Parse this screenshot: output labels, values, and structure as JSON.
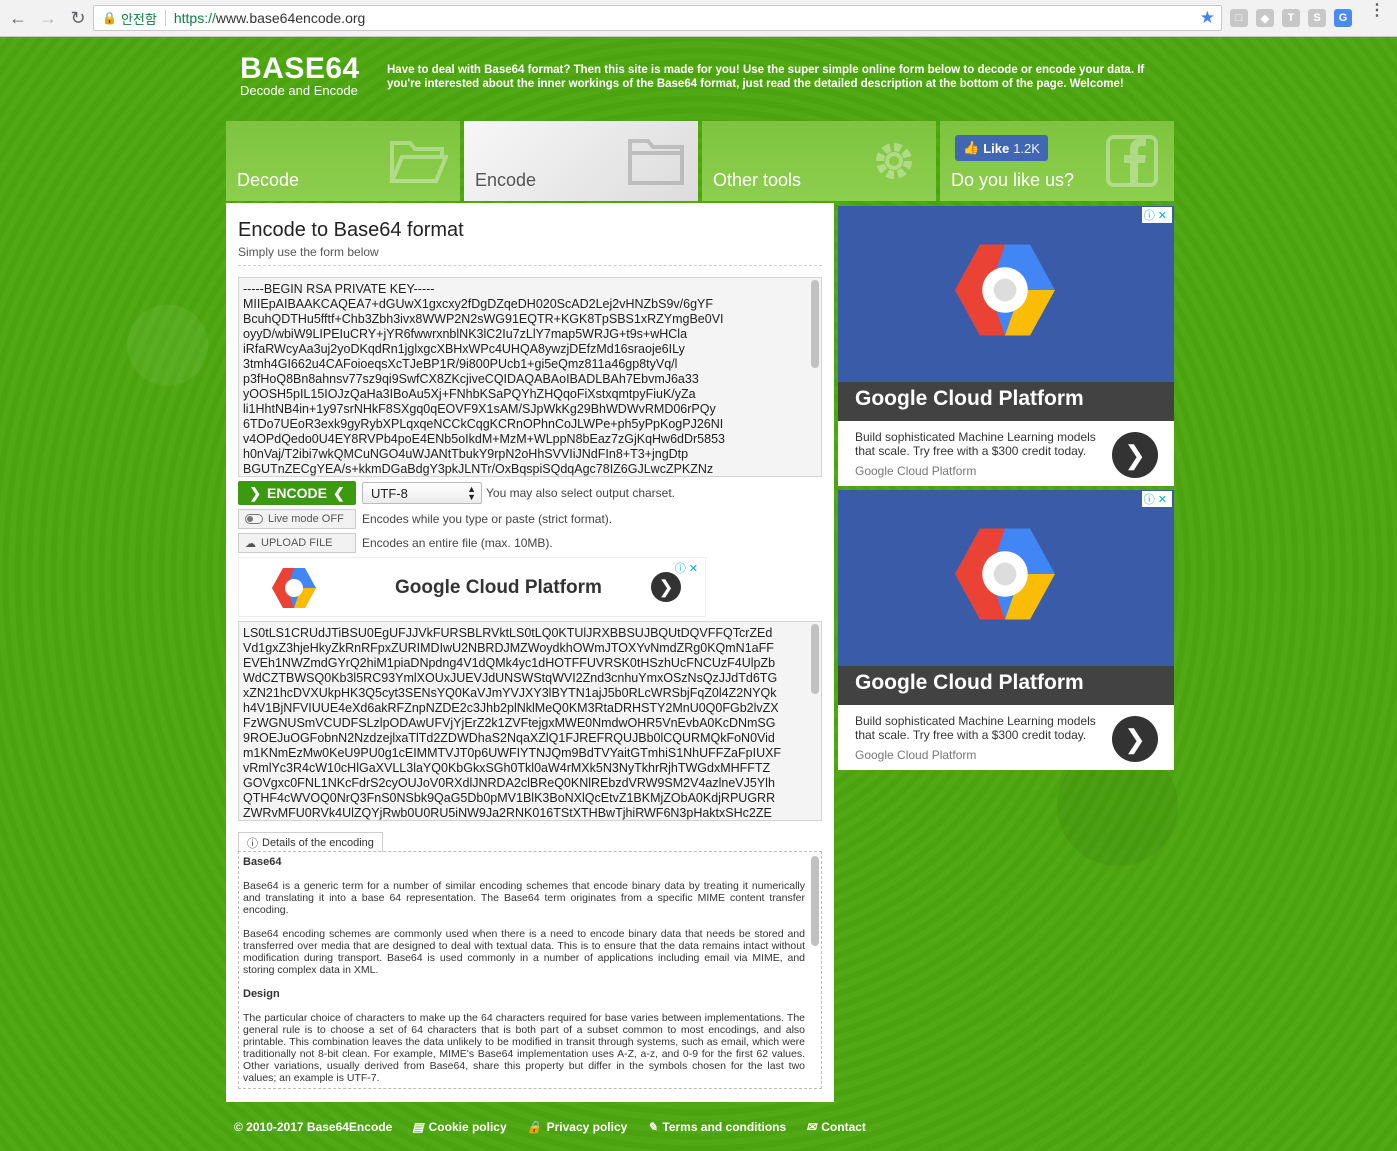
{
  "browser": {
    "secure_label": "안전함",
    "url_scheme": "https://",
    "url_host": "www.base64encode.org",
    "extensions": [
      "T",
      "S",
      "G"
    ]
  },
  "header": {
    "logo_title": "BASE64",
    "logo_sub": "Decode and Encode",
    "intro": "Have to deal with Base64 format? Then this site is made for you! Use the super simple online form below to decode or encode your data. If you're interested about the inner workings of the Base64 format, just read the detailed description at the bottom of the page. Welcome!"
  },
  "tabs": {
    "decode": "Decode",
    "encode": "Encode",
    "other_tools": "Other tools",
    "like_us": "Do you like us?",
    "fb_like": "Like",
    "fb_count": "1.2K"
  },
  "main": {
    "title": "Encode to Base64 format",
    "subtitle": "Simply use the form below",
    "input_lines": [
      "-----BEGIN RSA PRIVATE KEY-----",
      "MIIEpAIBAAKCAQEA7+dGUwX1gxcxy2fDgDZqeDH020ScAD2Lej2vHNZbS9v/6gYF",
      "BcuhQDTHu5fftf+Chb3Zbh3ivx8WWP2N2sWG91EQTR+KGK8TpSBS1xRZYmgBe0VI",
      "oyyD/wbiW9LIPEIuCRY+jYR6fwwrxnblNK3lC2Iu7zLlY7map5WRJG+t9s+wHCla",
      "iRfaRWcyAa3uj2yoDKqdRn1jglxgcXBHxWPc4UHQA8ywzjDEfzMd16sraoje6ILy",
      "3tmh4GI662u4CAFoioeqsXcTJeBP1R/9i800PUcb1+gi5eQmz811a46gp8tyVq/l",
      "p3fHoQ8Bn8ahnsv77sz9qi9SwfCX8ZKcjiveCQIDAQABAoIBADLBAh7EbvmJ6a33",
      "yOOSH5pIL15IOJzQaHa3IBoAu5Xj+FNhbKSaPQYhZHQqoFiXstxqmtpyFiuK/yZa",
      "li1HhtNB4in+1y97srNHkF8SXgq0qEOVF9X1sAM/SJpWkKg29BhWDWvRMD06rPQy",
      "6TDo7UEoR3exk9gyRybXPLqxqeNCCkCqgKCRnOPhnCoJLWPe+ph5yPpKogPJ26NI",
      "v4OPdQedo0U4EY8RVPb4poE4ENb5oIkdM+MzM+WLppN8bEaz7zGjKqHw6dDr5853",
      "h0nVaj/T2ibi7wkQMCuNGO4uWJANtTbukY9rpN2oHhSVVIiJNdFIn8+T3+jngDtp",
      "BGUTnZECgYEA/s+kkmDGaBdgY3pkJLNTr/OxBqspiSQdqAgc78IZ6GJLwcZPKZNz"
    ],
    "encode_btn": "ENCODE",
    "charset": "UTF-8",
    "charset_hint": "You may also select output charset.",
    "live_mode": "Live mode OFF",
    "live_hint": "Encodes while you type or paste (strict format).",
    "upload": "UPLOAD FILE",
    "upload_hint": "Encodes an entire file (max. 10MB).",
    "output_lines": [
      "LS0tLS1CRUdJTiBSU0EgUFJJVkFURSBLRVktLS0tLQ0KTUlJRXBBSUJBQUtDQVFFQTcrZEd",
      "Vd1gxZ3hjeHkyZkRnRFpxZURIMDIwU2NBRDJMZWoydkhOWmJTOXYvNmdZRg0KQmN1aFF",
      "EVEh1NWZmdGYrQ2hiM1piaDNpdng4V1dQMk4yc1dHOTFFUVRSK0tHSzhUcFNCUzF4UlpZb",
      "WdCZTBWSQ0Kb3l5RC93YmlXOUxJUEVJdUNSWStqWVI2Znd3cnhuYmxOSzNsQzJJdTd6TG",
      "xZN21hcDVXUkpHK3Q5cyt3SENsYQ0KaVJmYVJXY3lBYTN1ajJ5b0RLcWRSbjFqZ0l4Z2NYQk",
      "h4V1BjNFVIUUE4eXd6akRFZnpNZDE2c3Jhb2plNklMeQ0KM3RtaDRHSTY2MnU0Q0FGb2lvZX",
      "FzWGNUSmVCUDFSLzlpODAwUFVjYjErZ2k1ZVFtejgxMWE0NmdwOHR5VnEvbA0KcDNmSG",
      "9ROEJuOGFobnN2NzdzejlxaTlTd2ZDWDhaS2NqaXZlQ1FJREFRQUJBb0lCQURMQkFoN0Vid",
      "m1KNmEzMw0KeU9PU0g1cEIMMTVJT0p6UWFIYTNJQm9BdTVYaitGTmhiS1NhUFFZaFpIUXF",
      "vRmlYc3R4cW10cHlGaXVLL3laYQ0KbGkxSGh0Tkl0aW4rMXk5N3NyTkhrRjhTWGdxMHFFTZ",
      "GOVgxc0FNL1NKcFdrS2cyOUJoV0RXdlJNRDA2clBReQ0KNlREbzdVRW9SM2V4azlneVJ5Ylh",
      "QTHF4cWVOQ0NrQ3FnS0NSbk9QaG5Db0pMV1BlK3BoNXlQcEtvZ1BKMjZObA0KdjRPUGRR",
      "ZWRvMFU0RVk4UlZQYjRwb0U0RU5iNW9Ja2RNK016TStXTHBwTjhiRWF6N3pHaktxSHc2ZE"
    ],
    "ad_title": "Google Cloud Platform",
    "details_tab": "Details of the encoding",
    "details": {
      "h1": "Base64",
      "p1": "Base64 is a generic term for a number of similar encoding schemes that encode binary data by treating it numerically and translating it into a base 64 representation. The Base64 term originates from a specific MIME content transfer encoding.",
      "p2": "Base64 encoding schemes are commonly used when there is a need to encode binary data that needs be stored and transferred over media that are designed to deal with textual data. This is to ensure that the data remains intact without modification during transport. Base64 is used commonly in a number of applications including email via MIME, and storing complex data in XML.",
      "h2": "Design",
      "p3": "The particular choice of characters to make up the 64 characters required for base varies between implementations. The general rule is to choose a set of 64 characters that is both part of a subset common to most encodings, and also printable. This combination leaves the data unlikely to be modified in transit through systems, such as email, which were traditionally not 8-bit clean. For example, MIME's Base64 implementation uses A-Z, a-z, and 0-9 for the first 62 values. Other variations, usually derived from Base64, share this property but differ in the symbols chosen for the last two values; an example is UTF-7."
    }
  },
  "side_ads": [
    {
      "title": "Google Cloud Platform",
      "desc": "Build sophisticated Machine Learning models that scale. Try free with a $300 credit today.",
      "source": "Google Cloud Platform"
    },
    {
      "title": "Google Cloud Platform",
      "desc": "Build sophisticated Machine Learning models that scale. Try free with a $300 credit today.",
      "source": "Google Cloud Platform"
    }
  ],
  "footer": {
    "copyright": "© 2010-2017 Base64Encode",
    "cookie": "Cookie policy",
    "privacy": "Privacy policy",
    "terms": "Terms and conditions",
    "contact": "Contact"
  },
  "colors": {
    "page_bg": "#4ca70f",
    "encode_btn": "#3b9a12",
    "tab_green": "#7ec43e",
    "ad_blue": "#3a5ba8",
    "fb_blue": "#4267b2"
  }
}
